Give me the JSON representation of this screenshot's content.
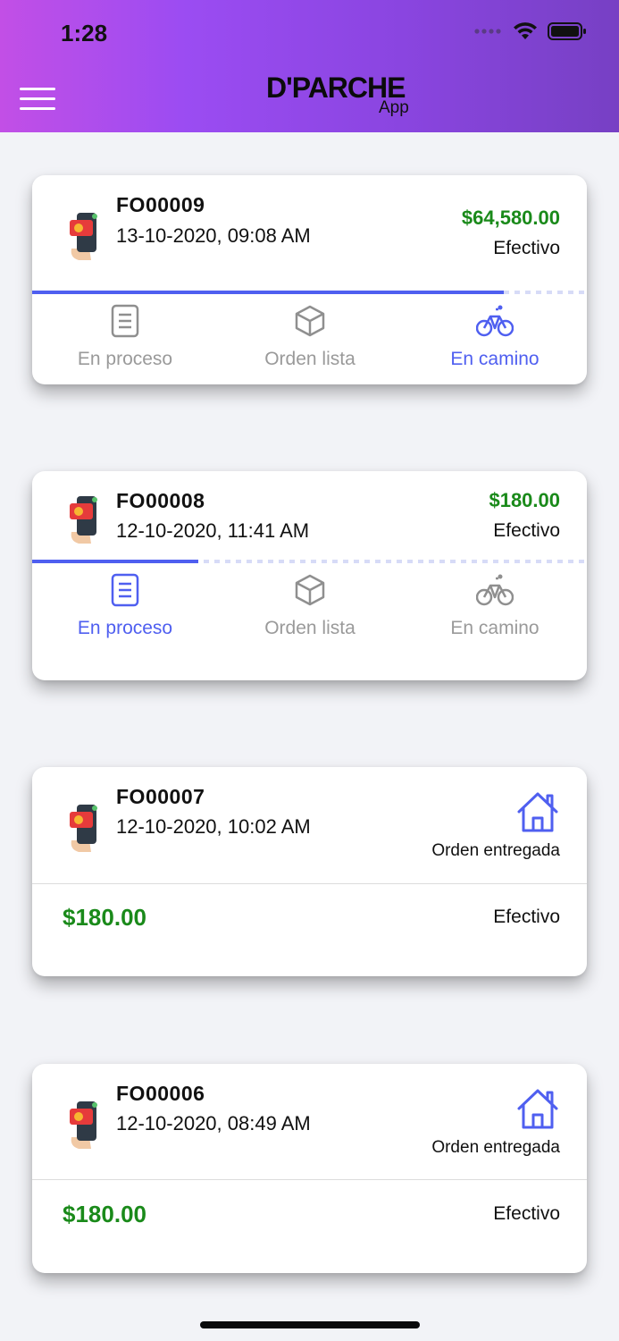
{
  "status_bar": {
    "time": "1:28"
  },
  "header": {
    "logo_main": "D'PARCHE",
    "logo_sub": "App"
  },
  "steps_labels": [
    "En proceso",
    "Orden lista",
    "En camino"
  ],
  "colors": {
    "accent": "#4f5ff0",
    "amount": "#1a8a1a",
    "header_start": "#c24fe6",
    "header_end": "#7740c4"
  },
  "orders": [
    {
      "id": "FO00009",
      "date": "13-10-2020, 09:08 AM",
      "amount": "$64,580.00",
      "payment": "Efectivo",
      "progress": 0.85,
      "active_step": "En camino"
    },
    {
      "id": "FO00008",
      "date": "12-10-2020, 11:41 AM",
      "amount": "$180.00",
      "payment": "Efectivo",
      "progress": 0.3,
      "active_step": "En proceso"
    },
    {
      "id": "FO00007",
      "date": "12-10-2020, 10:02 AM",
      "status": "Orden entregada",
      "amount": "$180.00",
      "payment": "Efectivo"
    },
    {
      "id": "FO00006",
      "date": "12-10-2020, 08:49 AM",
      "status": "Orden entregada",
      "amount": "$180.00",
      "payment": "Efectivo"
    }
  ]
}
